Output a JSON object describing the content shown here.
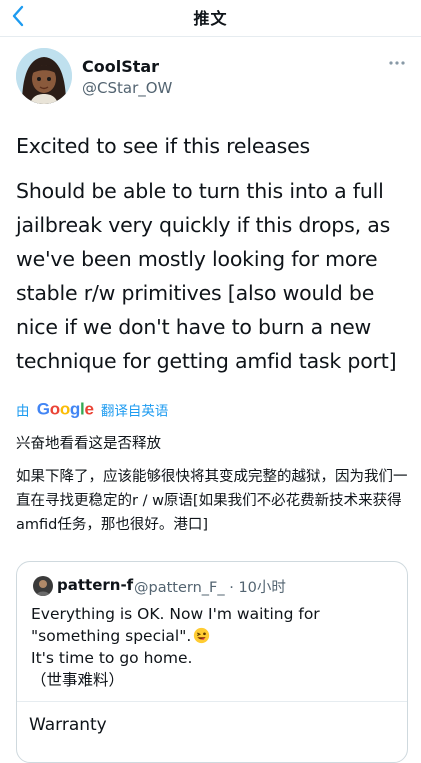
{
  "nav": {
    "title": "推文"
  },
  "author": {
    "display_name": "CoolStar",
    "handle": "@CStar_OW"
  },
  "tweet": {
    "text_line1": "Excited to see if this releases",
    "text_line2": "Should be able to turn this into a full jailbreak very quickly if this drops, as we've been mostly looking for more stable r/w primitives [also would be nice if we don't have to burn a new technique for getting amfid task port]"
  },
  "translate": {
    "prefix": "由",
    "brand": "Google",
    "suffix": "翻译自英语"
  },
  "translation": {
    "line1": "兴奋地看看这是否释放",
    "line2": "如果下降了，应该能够很快将其变成完整的越狱，因为我们一直在寻找更稳定的r / w原语[如果我们不必花费新技术来获得amfid任务，那也很好。港口]"
  },
  "quote": {
    "name": "pattern-f",
    "handle": "@pattern_F_",
    "time": "· 10小时",
    "lines": [
      "Everything is OK. Now I'm waiting for",
      "\"something special\".",
      "It's time to go home.",
      "（世事难料）"
    ],
    "emoji": "grinning-squinting-face",
    "card_title": "Warranty"
  },
  "colors": {
    "link": "#1d9bf0",
    "secondary": "#536471",
    "border": "#cfd9de"
  },
  "icons": {
    "back": "chevron-left-icon",
    "more": "more-horizontal-icon"
  }
}
